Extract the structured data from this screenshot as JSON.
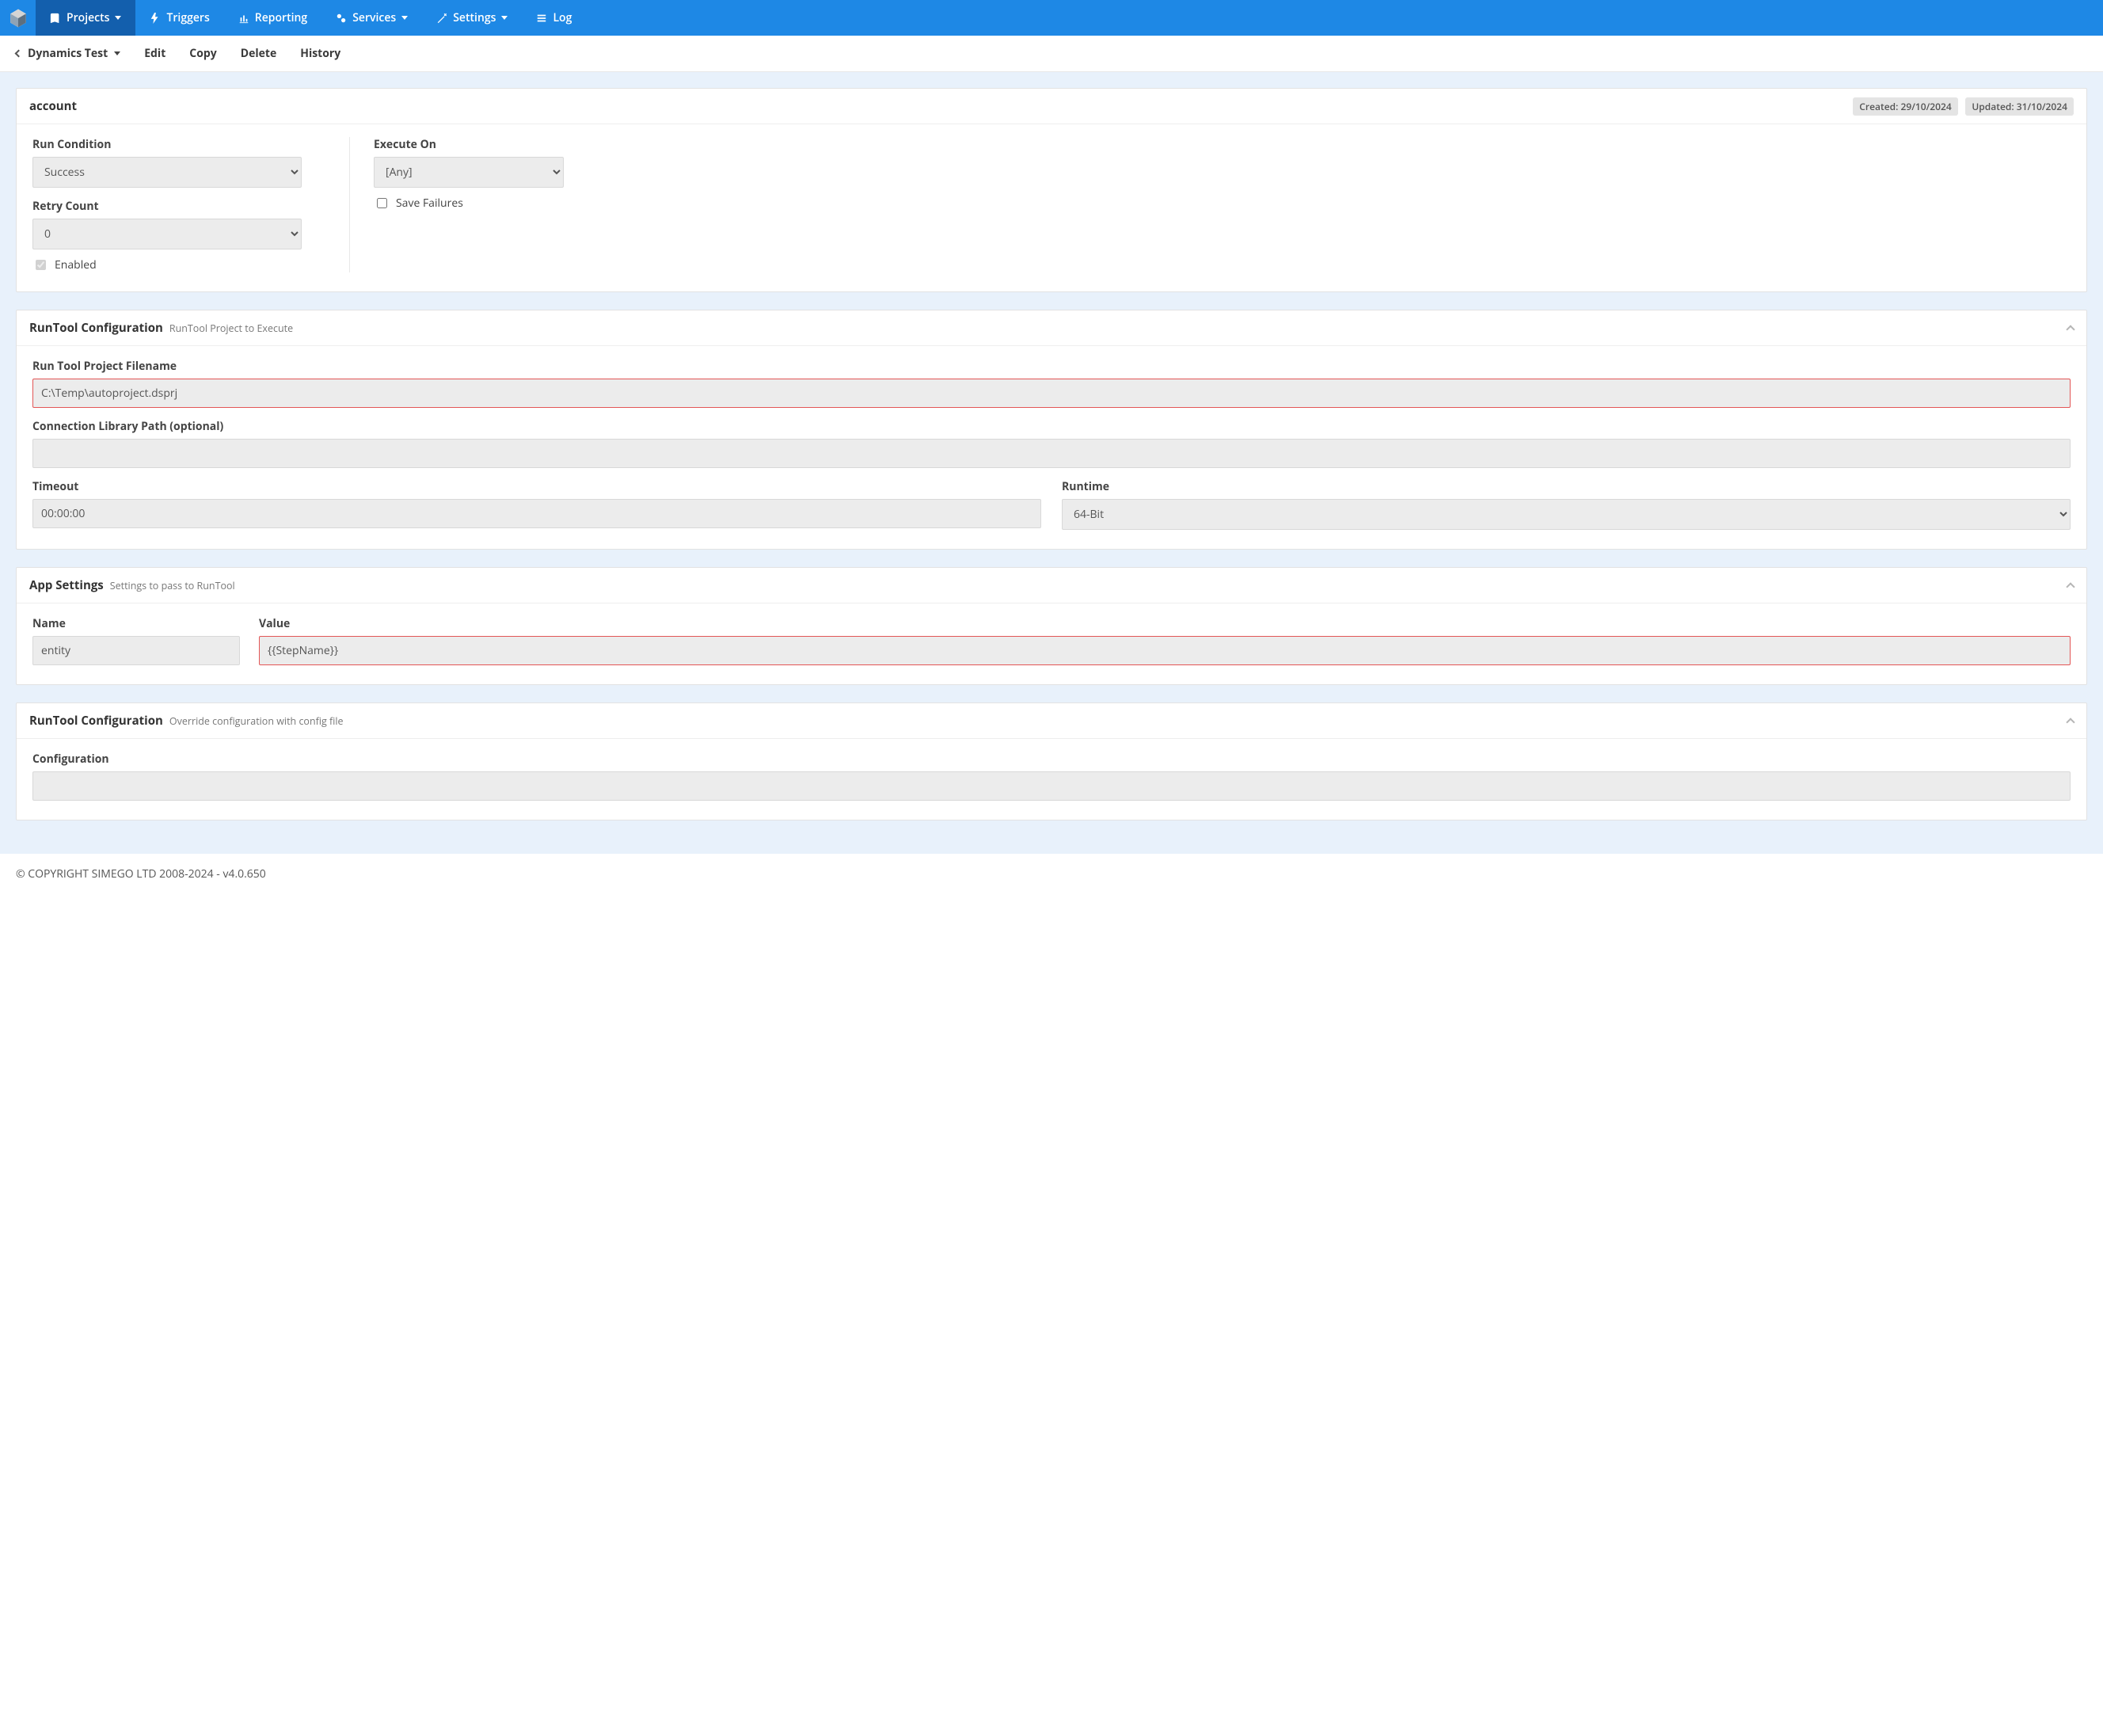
{
  "topnav": {
    "projects": "Projects",
    "triggers": "Triggers",
    "reporting": "Reporting",
    "services": "Services",
    "settings": "Settings",
    "log": "Log"
  },
  "secondbar": {
    "crumb": "Dynamics Test",
    "edit": "Edit",
    "copy": "Copy",
    "delete": "Delete",
    "history": "History"
  },
  "header": {
    "title": "account",
    "created_label": "Created: 29/10/2024",
    "updated_label": "Updated: 31/10/2024"
  },
  "run": {
    "run_condition_label": "Run Condition",
    "run_condition_value": "Success",
    "retry_count_label": "Retry Count",
    "retry_count_value": "0",
    "enabled_label": "Enabled",
    "enabled_checked": true,
    "execute_on_label": "Execute On",
    "execute_on_value": "[Any]",
    "save_failures_label": "Save Failures",
    "save_failures_checked": false
  },
  "runtool": {
    "section_title": "RunTool Configuration",
    "section_sub": "RunTool Project to Execute",
    "filename_label": "Run Tool Project Filename",
    "filename_value": "C:\\Temp\\autoproject.dsprj",
    "conn_lib_label": "Connection Library Path (optional)",
    "conn_lib_value": "",
    "timeout_label": "Timeout",
    "timeout_value": "00:00:00",
    "runtime_label": "Runtime",
    "runtime_value": "64-Bit"
  },
  "appsettings": {
    "section_title": "App Settings",
    "section_sub": "Settings to pass to RunTool",
    "name_label": "Name",
    "value_label": "Value",
    "rows": [
      {
        "name": "entity",
        "value": "{{StepName}}"
      }
    ]
  },
  "override": {
    "section_title": "RunTool Configuration",
    "section_sub": "Override configuration with config file",
    "config_label": "Configuration",
    "config_value": ""
  },
  "footer": "© COPYRIGHT SIMEGO LTD 2008-2024 - v4.0.650"
}
